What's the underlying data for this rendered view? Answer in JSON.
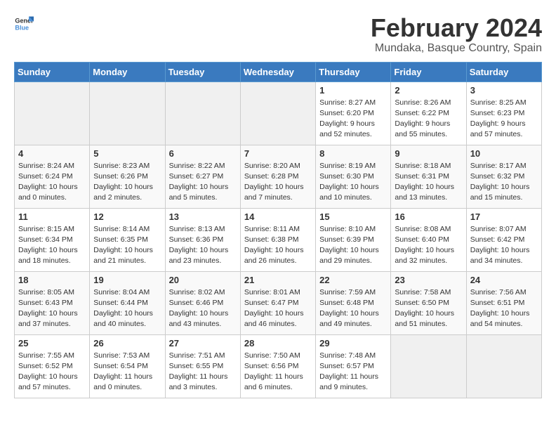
{
  "logo": {
    "text_general": "General",
    "text_blue": "Blue"
  },
  "title": "February 2024",
  "subtitle": "Mundaka, Basque Country, Spain",
  "days_of_week": [
    "Sunday",
    "Monday",
    "Tuesday",
    "Wednesday",
    "Thursday",
    "Friday",
    "Saturday"
  ],
  "weeks": [
    [
      {
        "day": "",
        "info": ""
      },
      {
        "day": "",
        "info": ""
      },
      {
        "day": "",
        "info": ""
      },
      {
        "day": "",
        "info": ""
      },
      {
        "day": "1",
        "info": "Sunrise: 8:27 AM\nSunset: 6:20 PM\nDaylight: 9 hours\nand 52 minutes."
      },
      {
        "day": "2",
        "info": "Sunrise: 8:26 AM\nSunset: 6:22 PM\nDaylight: 9 hours\nand 55 minutes."
      },
      {
        "day": "3",
        "info": "Sunrise: 8:25 AM\nSunset: 6:23 PM\nDaylight: 9 hours\nand 57 minutes."
      }
    ],
    [
      {
        "day": "4",
        "info": "Sunrise: 8:24 AM\nSunset: 6:24 PM\nDaylight: 10 hours\nand 0 minutes."
      },
      {
        "day": "5",
        "info": "Sunrise: 8:23 AM\nSunset: 6:26 PM\nDaylight: 10 hours\nand 2 minutes."
      },
      {
        "day": "6",
        "info": "Sunrise: 8:22 AM\nSunset: 6:27 PM\nDaylight: 10 hours\nand 5 minutes."
      },
      {
        "day": "7",
        "info": "Sunrise: 8:20 AM\nSunset: 6:28 PM\nDaylight: 10 hours\nand 7 minutes."
      },
      {
        "day": "8",
        "info": "Sunrise: 8:19 AM\nSunset: 6:30 PM\nDaylight: 10 hours\nand 10 minutes."
      },
      {
        "day": "9",
        "info": "Sunrise: 8:18 AM\nSunset: 6:31 PM\nDaylight: 10 hours\nand 13 minutes."
      },
      {
        "day": "10",
        "info": "Sunrise: 8:17 AM\nSunset: 6:32 PM\nDaylight: 10 hours\nand 15 minutes."
      }
    ],
    [
      {
        "day": "11",
        "info": "Sunrise: 8:15 AM\nSunset: 6:34 PM\nDaylight: 10 hours\nand 18 minutes."
      },
      {
        "day": "12",
        "info": "Sunrise: 8:14 AM\nSunset: 6:35 PM\nDaylight: 10 hours\nand 21 minutes."
      },
      {
        "day": "13",
        "info": "Sunrise: 8:13 AM\nSunset: 6:36 PM\nDaylight: 10 hours\nand 23 minutes."
      },
      {
        "day": "14",
        "info": "Sunrise: 8:11 AM\nSunset: 6:38 PM\nDaylight: 10 hours\nand 26 minutes."
      },
      {
        "day": "15",
        "info": "Sunrise: 8:10 AM\nSunset: 6:39 PM\nDaylight: 10 hours\nand 29 minutes."
      },
      {
        "day": "16",
        "info": "Sunrise: 8:08 AM\nSunset: 6:40 PM\nDaylight: 10 hours\nand 32 minutes."
      },
      {
        "day": "17",
        "info": "Sunrise: 8:07 AM\nSunset: 6:42 PM\nDaylight: 10 hours\nand 34 minutes."
      }
    ],
    [
      {
        "day": "18",
        "info": "Sunrise: 8:05 AM\nSunset: 6:43 PM\nDaylight: 10 hours\nand 37 minutes."
      },
      {
        "day": "19",
        "info": "Sunrise: 8:04 AM\nSunset: 6:44 PM\nDaylight: 10 hours\nand 40 minutes."
      },
      {
        "day": "20",
        "info": "Sunrise: 8:02 AM\nSunset: 6:46 PM\nDaylight: 10 hours\nand 43 minutes."
      },
      {
        "day": "21",
        "info": "Sunrise: 8:01 AM\nSunset: 6:47 PM\nDaylight: 10 hours\nand 46 minutes."
      },
      {
        "day": "22",
        "info": "Sunrise: 7:59 AM\nSunset: 6:48 PM\nDaylight: 10 hours\nand 49 minutes."
      },
      {
        "day": "23",
        "info": "Sunrise: 7:58 AM\nSunset: 6:50 PM\nDaylight: 10 hours\nand 51 minutes."
      },
      {
        "day": "24",
        "info": "Sunrise: 7:56 AM\nSunset: 6:51 PM\nDaylight: 10 hours\nand 54 minutes."
      }
    ],
    [
      {
        "day": "25",
        "info": "Sunrise: 7:55 AM\nSunset: 6:52 PM\nDaylight: 10 hours\nand 57 minutes."
      },
      {
        "day": "26",
        "info": "Sunrise: 7:53 AM\nSunset: 6:54 PM\nDaylight: 11 hours\nand 0 minutes."
      },
      {
        "day": "27",
        "info": "Sunrise: 7:51 AM\nSunset: 6:55 PM\nDaylight: 11 hours\nand 3 minutes."
      },
      {
        "day": "28",
        "info": "Sunrise: 7:50 AM\nSunset: 6:56 PM\nDaylight: 11 hours\nand 6 minutes."
      },
      {
        "day": "29",
        "info": "Sunrise: 7:48 AM\nSunset: 6:57 PM\nDaylight: 11 hours\nand 9 minutes."
      },
      {
        "day": "",
        "info": ""
      },
      {
        "day": "",
        "info": ""
      }
    ]
  ]
}
